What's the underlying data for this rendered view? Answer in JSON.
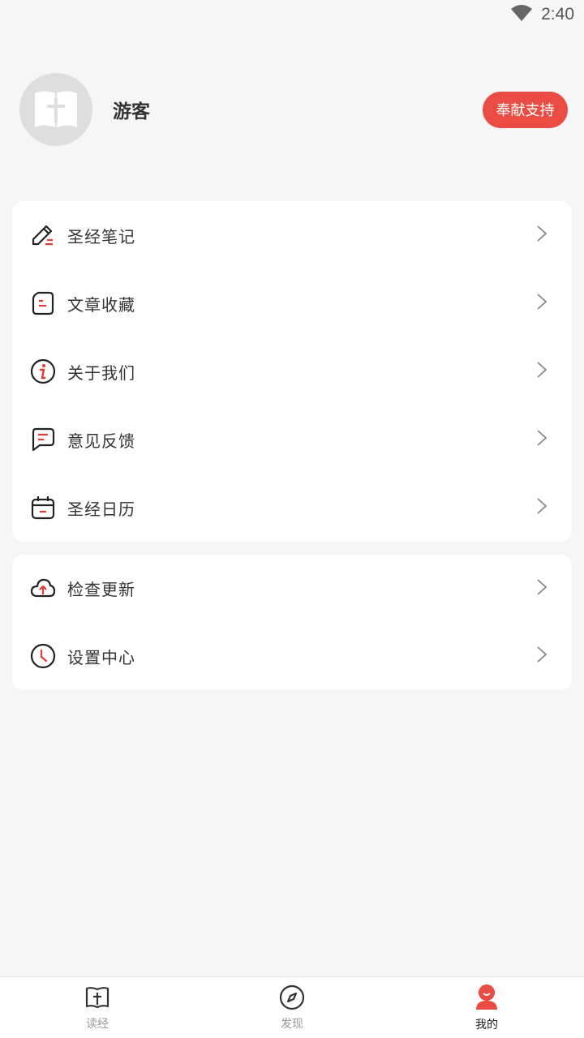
{
  "status": {
    "time": "2:40"
  },
  "profile": {
    "username": "游客",
    "donate_label": "奉献支持"
  },
  "menu_group_1": [
    {
      "label": "圣经笔记",
      "icon": "edit-note-icon"
    },
    {
      "label": "文章收藏",
      "icon": "bookmark-collection-icon"
    },
    {
      "label": "关于我们",
      "icon": "info-icon"
    },
    {
      "label": "意见反馈",
      "icon": "feedback-chat-icon"
    },
    {
      "label": "圣经日历",
      "icon": "calendar-icon"
    }
  ],
  "menu_group_2": [
    {
      "label": "检查更新",
      "icon": "cloud-upload-icon"
    },
    {
      "label": "设置中心",
      "icon": "clock-settings-icon"
    }
  ],
  "tabs": [
    {
      "label": "读经",
      "icon": "bible-book-icon",
      "active": false
    },
    {
      "label": "发现",
      "icon": "compass-icon",
      "active": false
    },
    {
      "label": "我的",
      "icon": "user-profile-icon",
      "active": true
    }
  ],
  "colors": {
    "accent": "#ea4b43",
    "background": "#f6f6f6"
  }
}
